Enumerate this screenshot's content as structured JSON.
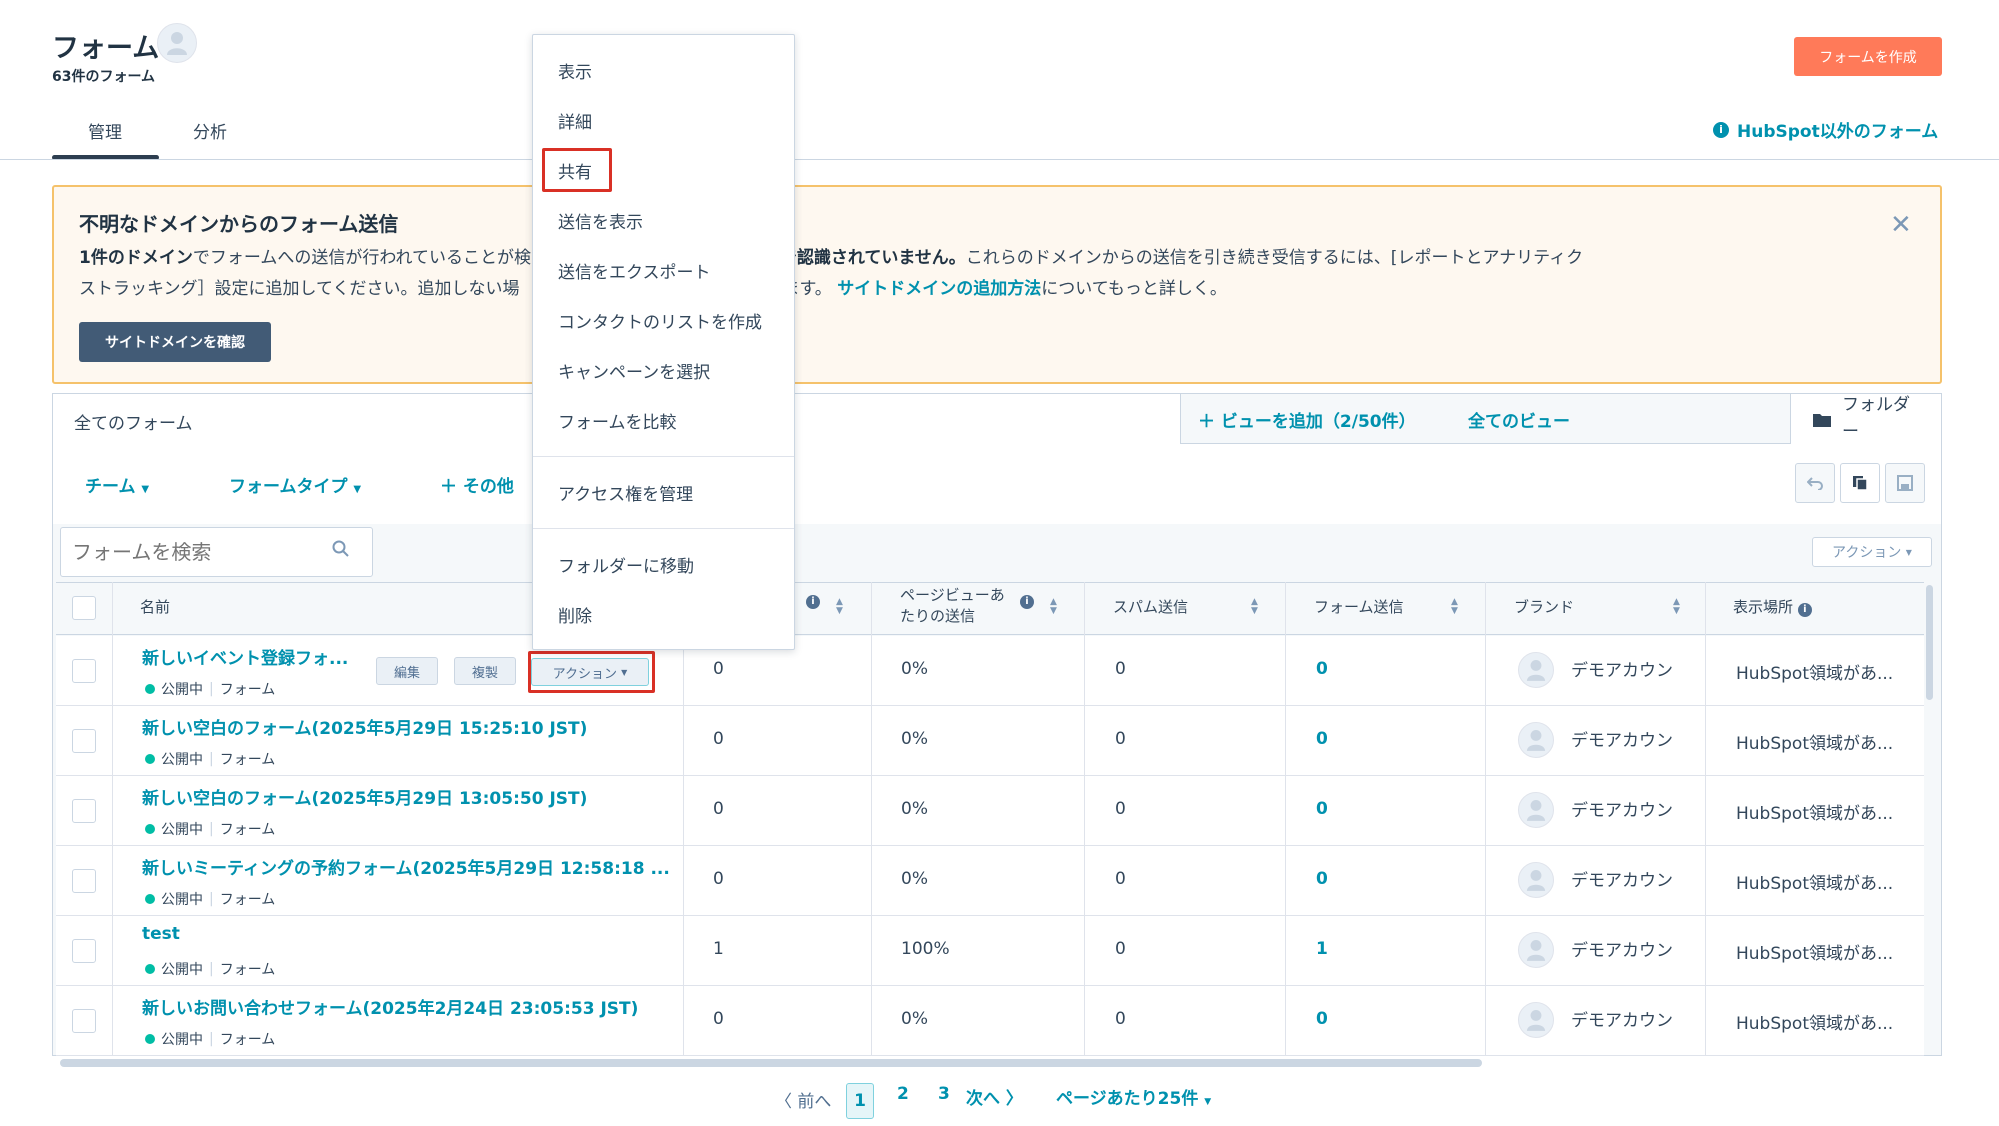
{
  "header": {
    "title": "フォーム",
    "count": "63件のフォーム",
    "create_button": "フォームを作成",
    "tabs": [
      "管理",
      "分析"
    ],
    "nonhubspot_link": "HubSpot以外のフォーム"
  },
  "alert": {
    "title": "不明なドメインからのフォーム送信",
    "line1_bold": "1件のドメイン",
    "line1_a": "でフォームへの送信が行われていることが検",
    "line1_hidden_gap": "",
    "line1_b_bold": "はHubSpotアナリティクスで認識されていません。",
    "line1_c": "これらのドメインからの送信を引き続き受信するには、[レポートとアナリティク",
    "line2_a": "ストラッキング］設定に追加してください。追加しない場",
    "line2_b": "除されます。",
    "line2_link": "サイトドメインの追加方法",
    "line2_c": "についてもっと詳しく。",
    "button": "サイトドメインを確認"
  },
  "views": {
    "current": "全てのフォーム",
    "add_view": "ビューを追加（2/50件）",
    "all_views": "全てのビュー",
    "folder": "フォルダー"
  },
  "filters": {
    "team": "チーム",
    "form_type": "フォームタイプ",
    "more": "その他"
  },
  "search": {
    "placeholder": "フォームを検索"
  },
  "table_actions": "アクション",
  "columns": {
    "name": "名前",
    "pageview_rate": "ページビューあたりの送信",
    "spam": "スパム送信",
    "submissions": "フォーム送信",
    "brand": "ブランド",
    "location": "表示場所"
  },
  "row_buttons": {
    "edit": "編集",
    "clone": "複製",
    "actions": "アクション"
  },
  "status_text": "公開中",
  "type_text": "フォーム",
  "rows": [
    {
      "name": "新しいイベント登録フォ...",
      "views": "0",
      "rate": "0%",
      "spam": "0",
      "subs": "0",
      "brand": "デモアカウン",
      "location": "HubSpot領域があ..."
    },
    {
      "name": "新しい空白のフォーム(2025年5月29日 15:25:10 JST)",
      "views": "0",
      "rate": "0%",
      "spam": "0",
      "subs": "0",
      "brand": "デモアカウン",
      "location": "HubSpot領域があ..."
    },
    {
      "name": "新しい空白のフォーム(2025年5月29日 13:05:50 JST)",
      "views": "0",
      "rate": "0%",
      "spam": "0",
      "subs": "0",
      "brand": "デモアカウン",
      "location": "HubSpot領域があ..."
    },
    {
      "name": "新しいミーティングの予約フォーム(2025年5月29日 12:58:18 ...",
      "views": "0",
      "rate": "0%",
      "spam": "0",
      "subs": "0",
      "brand": "デモアカウン",
      "location": "HubSpot領域があ..."
    },
    {
      "name": "test",
      "views": "1",
      "rate": "100%",
      "spam": "0",
      "subs": "1",
      "brand": "デモアカウン",
      "location": "HubSpot領域があ..."
    },
    {
      "name": "新しいお問い合わせフォーム(2025年2月24日 23:05:53 JST)",
      "views": "0",
      "rate": "0%",
      "spam": "0",
      "subs": "0",
      "brand": "デモアカウン",
      "location": "HubSpot領域があ..."
    }
  ],
  "pagination": {
    "prev": "前へ",
    "pages": [
      "1",
      "2",
      "3"
    ],
    "next": "次へ",
    "per_page": "ページあたり25件"
  },
  "menu": {
    "items": [
      "表示",
      "詳細",
      "共有",
      "送信を表示",
      "送信をエクスポート",
      "コンタクトのリストを作成",
      "キャンペーンを選択",
      "フォームを比較",
      "アクセス権を管理",
      "フォルダーに移動",
      "削除"
    ]
  },
  "colors": {
    "accent": "#0091ae",
    "primary_button": "#ff7a59",
    "highlight": "#d93025",
    "status_published": "#00bda5"
  }
}
